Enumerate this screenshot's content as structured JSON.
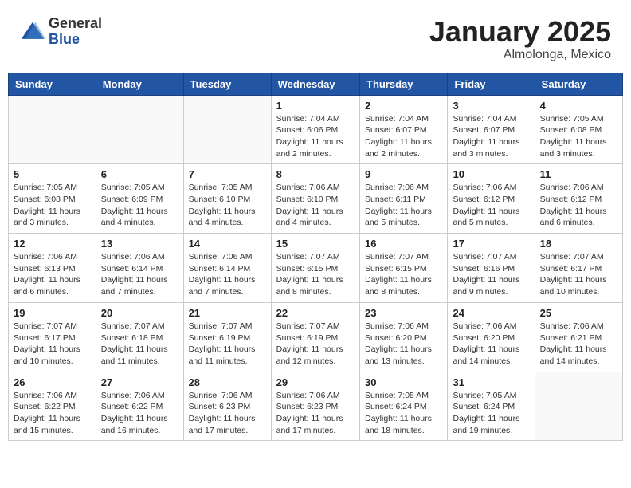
{
  "logo": {
    "general": "General",
    "blue": "Blue"
  },
  "title": "January 2025",
  "location": "Almolonga, Mexico",
  "weekdays": [
    "Sunday",
    "Monday",
    "Tuesday",
    "Wednesday",
    "Thursday",
    "Friday",
    "Saturday"
  ],
  "weeks": [
    [
      {
        "day": null
      },
      {
        "day": null
      },
      {
        "day": null
      },
      {
        "day": "1",
        "sunrise": "Sunrise: 7:04 AM",
        "sunset": "Sunset: 6:06 PM",
        "daylight": "Daylight: 11 hours and 2 minutes."
      },
      {
        "day": "2",
        "sunrise": "Sunrise: 7:04 AM",
        "sunset": "Sunset: 6:07 PM",
        "daylight": "Daylight: 11 hours and 2 minutes."
      },
      {
        "day": "3",
        "sunrise": "Sunrise: 7:04 AM",
        "sunset": "Sunset: 6:07 PM",
        "daylight": "Daylight: 11 hours and 3 minutes."
      },
      {
        "day": "4",
        "sunrise": "Sunrise: 7:05 AM",
        "sunset": "Sunset: 6:08 PM",
        "daylight": "Daylight: 11 hours and 3 minutes."
      }
    ],
    [
      {
        "day": "5",
        "sunrise": "Sunrise: 7:05 AM",
        "sunset": "Sunset: 6:08 PM",
        "daylight": "Daylight: 11 hours and 3 minutes."
      },
      {
        "day": "6",
        "sunrise": "Sunrise: 7:05 AM",
        "sunset": "Sunset: 6:09 PM",
        "daylight": "Daylight: 11 hours and 4 minutes."
      },
      {
        "day": "7",
        "sunrise": "Sunrise: 7:05 AM",
        "sunset": "Sunset: 6:10 PM",
        "daylight": "Daylight: 11 hours and 4 minutes."
      },
      {
        "day": "8",
        "sunrise": "Sunrise: 7:06 AM",
        "sunset": "Sunset: 6:10 PM",
        "daylight": "Daylight: 11 hours and 4 minutes."
      },
      {
        "day": "9",
        "sunrise": "Sunrise: 7:06 AM",
        "sunset": "Sunset: 6:11 PM",
        "daylight": "Daylight: 11 hours and 5 minutes."
      },
      {
        "day": "10",
        "sunrise": "Sunrise: 7:06 AM",
        "sunset": "Sunset: 6:12 PM",
        "daylight": "Daylight: 11 hours and 5 minutes."
      },
      {
        "day": "11",
        "sunrise": "Sunrise: 7:06 AM",
        "sunset": "Sunset: 6:12 PM",
        "daylight": "Daylight: 11 hours and 6 minutes."
      }
    ],
    [
      {
        "day": "12",
        "sunrise": "Sunrise: 7:06 AM",
        "sunset": "Sunset: 6:13 PM",
        "daylight": "Daylight: 11 hours and 6 minutes."
      },
      {
        "day": "13",
        "sunrise": "Sunrise: 7:06 AM",
        "sunset": "Sunset: 6:14 PM",
        "daylight": "Daylight: 11 hours and 7 minutes."
      },
      {
        "day": "14",
        "sunrise": "Sunrise: 7:06 AM",
        "sunset": "Sunset: 6:14 PM",
        "daylight": "Daylight: 11 hours and 7 minutes."
      },
      {
        "day": "15",
        "sunrise": "Sunrise: 7:07 AM",
        "sunset": "Sunset: 6:15 PM",
        "daylight": "Daylight: 11 hours and 8 minutes."
      },
      {
        "day": "16",
        "sunrise": "Sunrise: 7:07 AM",
        "sunset": "Sunset: 6:15 PM",
        "daylight": "Daylight: 11 hours and 8 minutes."
      },
      {
        "day": "17",
        "sunrise": "Sunrise: 7:07 AM",
        "sunset": "Sunset: 6:16 PM",
        "daylight": "Daylight: 11 hours and 9 minutes."
      },
      {
        "day": "18",
        "sunrise": "Sunrise: 7:07 AM",
        "sunset": "Sunset: 6:17 PM",
        "daylight": "Daylight: 11 hours and 10 minutes."
      }
    ],
    [
      {
        "day": "19",
        "sunrise": "Sunrise: 7:07 AM",
        "sunset": "Sunset: 6:17 PM",
        "daylight": "Daylight: 11 hours and 10 minutes."
      },
      {
        "day": "20",
        "sunrise": "Sunrise: 7:07 AM",
        "sunset": "Sunset: 6:18 PM",
        "daylight": "Daylight: 11 hours and 11 minutes."
      },
      {
        "day": "21",
        "sunrise": "Sunrise: 7:07 AM",
        "sunset": "Sunset: 6:19 PM",
        "daylight": "Daylight: 11 hours and 11 minutes."
      },
      {
        "day": "22",
        "sunrise": "Sunrise: 7:07 AM",
        "sunset": "Sunset: 6:19 PM",
        "daylight": "Daylight: 11 hours and 12 minutes."
      },
      {
        "day": "23",
        "sunrise": "Sunrise: 7:06 AM",
        "sunset": "Sunset: 6:20 PM",
        "daylight": "Daylight: 11 hours and 13 minutes."
      },
      {
        "day": "24",
        "sunrise": "Sunrise: 7:06 AM",
        "sunset": "Sunset: 6:20 PM",
        "daylight": "Daylight: 11 hours and 14 minutes."
      },
      {
        "day": "25",
        "sunrise": "Sunrise: 7:06 AM",
        "sunset": "Sunset: 6:21 PM",
        "daylight": "Daylight: 11 hours and 14 minutes."
      }
    ],
    [
      {
        "day": "26",
        "sunrise": "Sunrise: 7:06 AM",
        "sunset": "Sunset: 6:22 PM",
        "daylight": "Daylight: 11 hours and 15 minutes."
      },
      {
        "day": "27",
        "sunrise": "Sunrise: 7:06 AM",
        "sunset": "Sunset: 6:22 PM",
        "daylight": "Daylight: 11 hours and 16 minutes."
      },
      {
        "day": "28",
        "sunrise": "Sunrise: 7:06 AM",
        "sunset": "Sunset: 6:23 PM",
        "daylight": "Daylight: 11 hours and 17 minutes."
      },
      {
        "day": "29",
        "sunrise": "Sunrise: 7:06 AM",
        "sunset": "Sunset: 6:23 PM",
        "daylight": "Daylight: 11 hours and 17 minutes."
      },
      {
        "day": "30",
        "sunrise": "Sunrise: 7:05 AM",
        "sunset": "Sunset: 6:24 PM",
        "daylight": "Daylight: 11 hours and 18 minutes."
      },
      {
        "day": "31",
        "sunrise": "Sunrise: 7:05 AM",
        "sunset": "Sunset: 6:24 PM",
        "daylight": "Daylight: 11 hours and 19 minutes."
      },
      {
        "day": null
      }
    ]
  ]
}
